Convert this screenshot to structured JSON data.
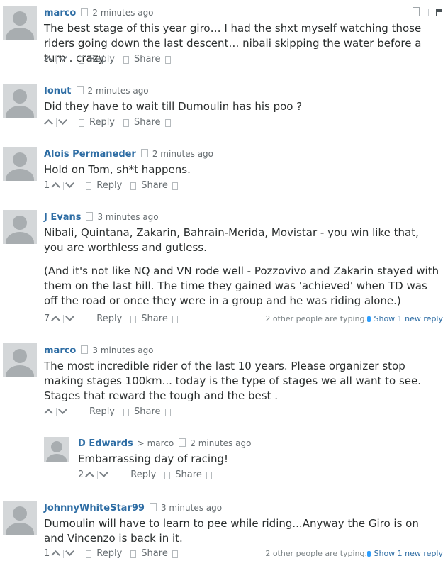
{
  "labels": {
    "reply": "Reply",
    "share": "Share"
  },
  "comments": [
    {
      "author": "marco",
      "time": "2 minutes ago",
      "votes": "",
      "paragraphs": [
        "The best stage of this year giro… I had the shxt myself watching those riders going down the last descent… nibali skipping the water before a turn . crazy"
      ]
    },
    {
      "author": "Ionut",
      "time": "2 minutes ago",
      "votes": "",
      "paragraphs": [
        "Did they have to wait till Dumoulin has his poo ?"
      ]
    },
    {
      "author": "Alois Permaneder",
      "time": "2 minutes ago",
      "votes": "1",
      "paragraphs": [
        "Hold on Tom, sh*t happens."
      ]
    },
    {
      "author": "J Evans",
      "time": "3 minutes ago",
      "votes": "7",
      "paragraphs": [
        "Nibali, Quintana, Zakarin, Bahrain-Merida, Movistar - you win like that, you are worthless and gutless.",
        "(And it's not like NQ and VN rode well - Pozzovivo and Zakarin stayed with them on the last hill. The time they gained was 'achieved' when TD was off the road or once they were in a group and he was riding alone.)"
      ],
      "typing": "2 other people are typing...",
      "show_new": "Show 1 new reply"
    },
    {
      "author": "marco",
      "time": "3 minutes ago",
      "votes": "",
      "paragraphs": [
        "The most incredible rider of the last 10 years. Please organizer stop making stages 100km... today is the type of stages we all want to see. Stages that reward the tough and the best ."
      ]
    },
    {
      "author": "D Edwards",
      "parent": "> marco",
      "time": "2 minutes ago",
      "votes": "2",
      "paragraphs": [
        "Embarrassing day of racing!"
      ]
    },
    {
      "author": "JohnnyWhiteStar99",
      "time": "3 minutes ago",
      "votes": "1",
      "paragraphs": [
        "Dumoulin will have to learn to pee while riding...Anyway the Giro is on and Vincenzo is back in it."
      ],
      "typing": "2 other people are typing...",
      "show_new": "Show 1 new reply"
    }
  ]
}
